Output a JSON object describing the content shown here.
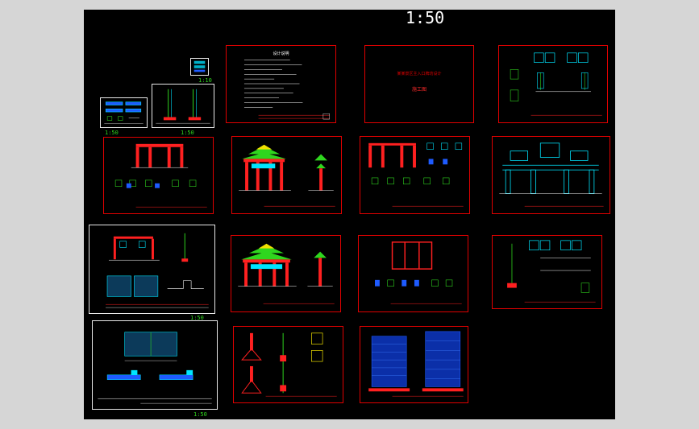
{
  "viewer": {
    "drawing_scale_main": "1:50",
    "scale_labels": {
      "small_sheet_a": "1:10",
      "small_sheet_b": "1:50",
      "left_sheet_1": "1:50",
      "left_sheet_3": "1:50",
      "left_sheet_4": "1:50"
    },
    "cover_sheet": {
      "title": "某某景区主入口牌坊设计",
      "subtitle": "施工图"
    },
    "notes_sheet": {
      "title": "设计说明"
    }
  },
  "colors": {
    "background": "#000000",
    "frame_red": "#e00000",
    "frame_white": "#e8e8e8",
    "line_cyan": "#00e5ff",
    "line_green": "#2fd61e",
    "line_red": "#ff2020",
    "line_blue": "#1e5bff",
    "line_yellow": "#f0e000",
    "line_white": "#ffffff"
  }
}
